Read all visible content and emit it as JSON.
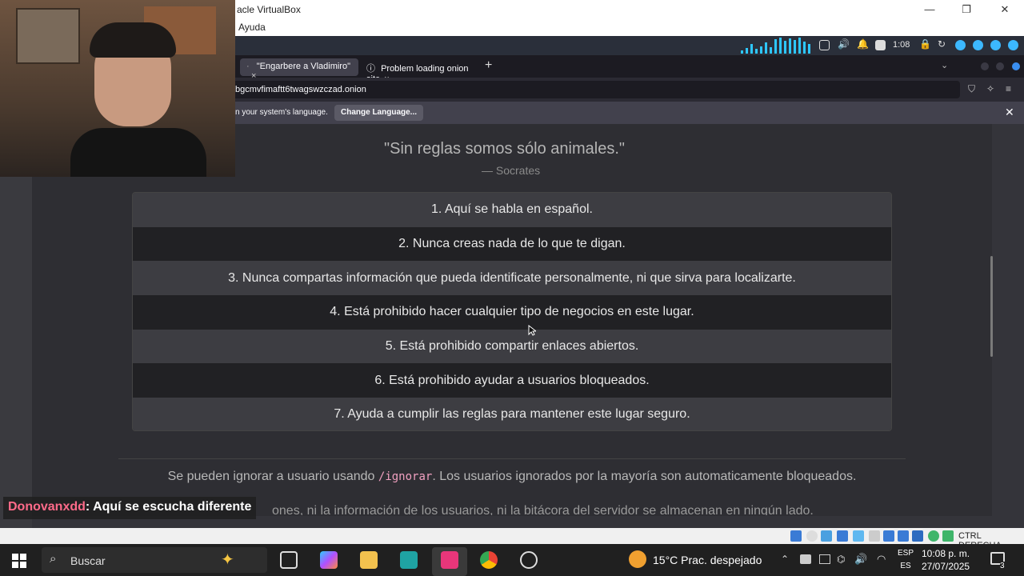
{
  "vbox": {
    "title": "acle VirtualBox",
    "menu_item": "Ayuda",
    "status_label": "CTRL DERECHA"
  },
  "guest": {
    "time": "1:08"
  },
  "browser": {
    "tabs": [
      {
        "label": "\"Engarbere a Vladimiro\"",
        "active": true
      },
      {
        "label": "Problem loading onion site",
        "active": false
      }
    ],
    "url": "bgcmvfimaftt6twagswzczad.onion",
    "notification": {
      "message": "n your system's language.",
      "button": "Change Language..."
    }
  },
  "page": {
    "quote": "\"Sin reglas somos sólo animales.\"",
    "author": "— Socrates",
    "rules": [
      "1. Aquí se habla en español.",
      "2. Nunca creas nada de lo que te digan.",
      "3. Nunca compartas información que pueda identificate personalmente, ni que sirva para localizarte.",
      "4. Está prohibido hacer cualquier tipo de negocios en este lugar.",
      "5. Está prohibido compartir enlaces abiertos.",
      "6. Está prohibido ayudar a usuarios bloqueados.",
      "7. Ayuda a cumplir las reglas para mantener este lugar seguro."
    ],
    "info_prefix": "Se pueden ignorar a usuario usando ",
    "info_command": "/ignorar",
    "info_suffix": ". Los usuarios ignorados por la mayoría son automaticamente bloqueados.",
    "info2": "ones, ni la información de los usuarios, ni la bitácora del servidor se almacenan en ningún lado."
  },
  "stream": {
    "chat_user": "Donovanxdd",
    "chat_message": ": Aquí se escucha diferente"
  },
  "taskbar": {
    "search_placeholder": "Buscar",
    "weather": "15°C  Prac. despejado",
    "lang_top": "ESP",
    "lang_bottom": "ES",
    "time": "10:08 p. m.",
    "date": "27/07/2025",
    "notifications": "3"
  },
  "colors": {
    "page_bg": "#2e2e33",
    "row_light": "#3d3d42",
    "row_dark": "#212124",
    "command": "#f0a0c0",
    "chat_user": "#ff6b8a"
  }
}
